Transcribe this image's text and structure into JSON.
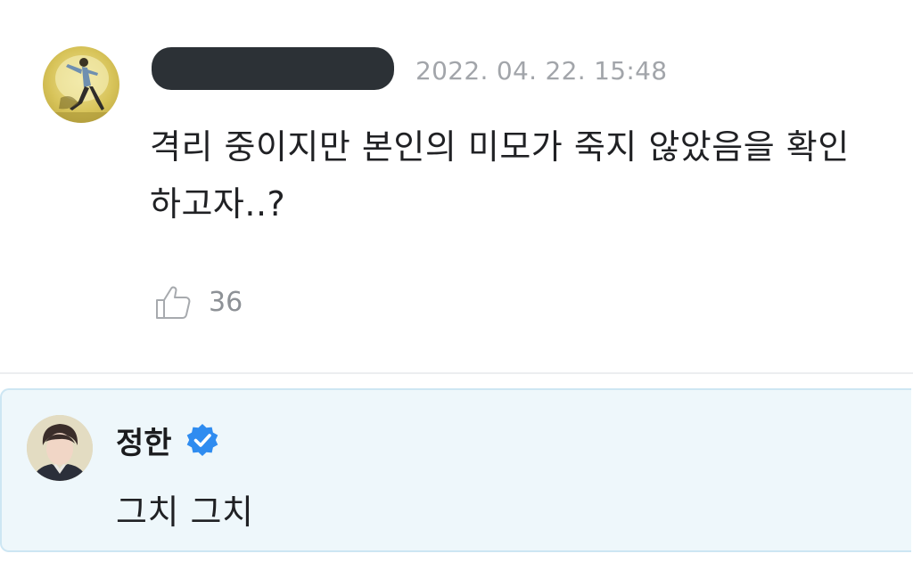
{
  "comment": {
    "author_redacted": true,
    "timestamp": "2022. 04. 22. 15:48",
    "text": "격리 중이지만 본인의 미모가 죽지 않았음을 확인하고자..?",
    "like_icon": "thumbs-up-icon",
    "like_count": "36"
  },
  "reply": {
    "author": "정한",
    "verified_icon": "verified-badge-icon",
    "text": "그치 그치",
    "colors": {
      "background": "#eef7fb",
      "border": "#cde6f3",
      "badge": "#2f8cf0"
    }
  }
}
